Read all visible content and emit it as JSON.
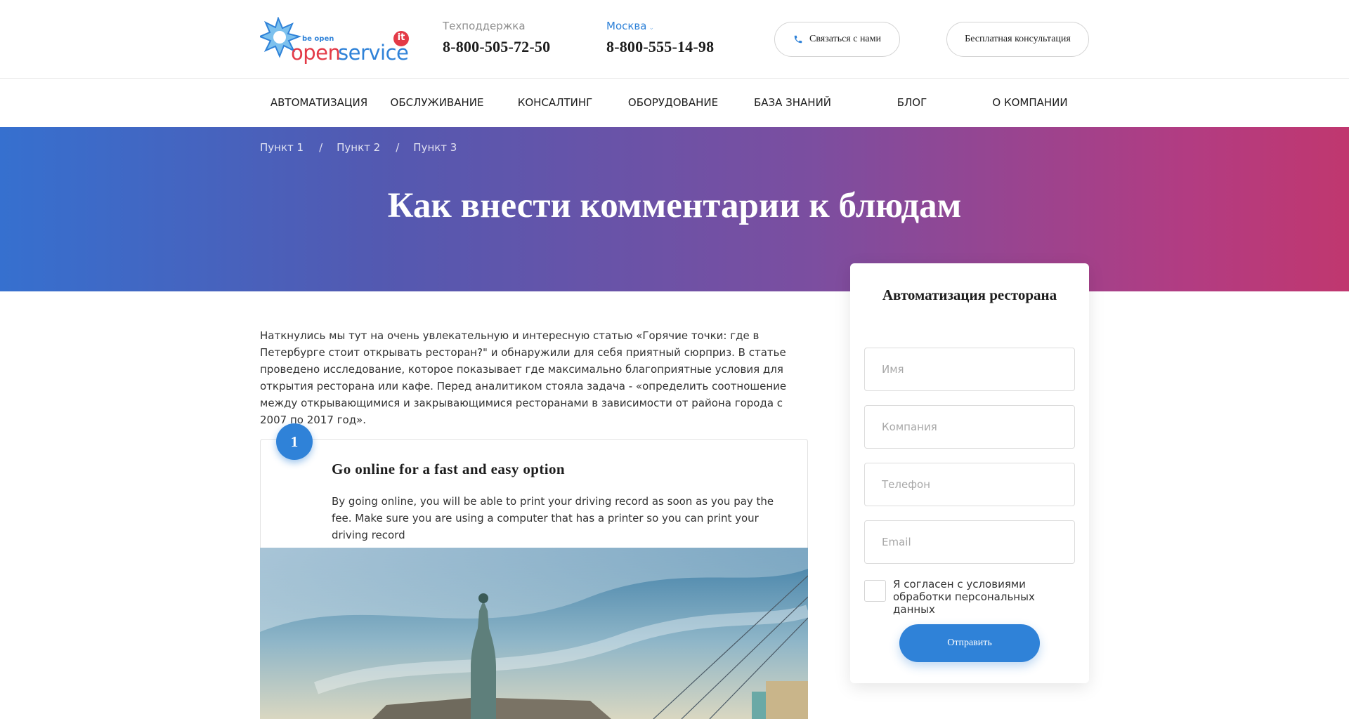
{
  "header": {
    "logo": {
      "tagline": "be open",
      "name_part1": "open",
      "name_part2": "service",
      "badge": "it"
    },
    "support": {
      "label": "Техподдержка",
      "phone": "8-800-505-72-50"
    },
    "city": {
      "label": "Москва",
      "phone": "8-800-555-14-98"
    },
    "contact_button": "Связаться с нами",
    "consult_button": "Бесплатная консультация"
  },
  "nav": {
    "items": [
      {
        "label": "АВТОМАТИЗАЦИЯ"
      },
      {
        "label": "ОБСЛУЖИВАНИЕ"
      },
      {
        "label": "КОНСАЛТИНГ"
      },
      {
        "label": "ОБОРУДОВАНИЕ"
      },
      {
        "label": "БАЗА ЗНАНИЙ"
      },
      {
        "label": "БЛОГ"
      },
      {
        "label": "О КОМПАНИИ"
      }
    ]
  },
  "breadcrumb": {
    "items": [
      "Пункт 1",
      "Пункт 2",
      "Пункт 3"
    ],
    "separator": "/"
  },
  "page": {
    "title": "Как внести комментарии к блюдам"
  },
  "article": {
    "intro": "Наткнулись мы тут на очень увлекательную и интересную статью «Горячие точки: где в Петербурге стоит открывать ресторан?\" и обнаружили для себя приятный сюрприз. В статье проведено исследование, которое показывает где максимально благоприятные условия для открытия ресторана или кафе. Перед аналитиком стояла задача - «определить соотношение между открывающимися и закрывающимися ресторанами в зависимости от района города с 2007 по 2017 год».",
    "step": {
      "number": "1",
      "title": "Go online for a fast and easy option",
      "text": "By going online, you will be able to print your driving record as soon as you pay the fee. Make sure you are using a computer that has a printer so you can print your driving record"
    }
  },
  "form": {
    "title": "Автоматизация ресторана",
    "fields": [
      {
        "placeholder": "Имя"
      },
      {
        "placeholder": "Компания"
      },
      {
        "placeholder": "Телефон"
      },
      {
        "placeholder": "Email"
      }
    ],
    "agree_text": "Я согласен с условиями обработки персональных данных",
    "submit": "Отправить"
  },
  "colors": {
    "accent": "#2f82d8",
    "brand_red": "#e33a47",
    "gradient_start": "#3670cf",
    "gradient_end": "#c0376f"
  }
}
